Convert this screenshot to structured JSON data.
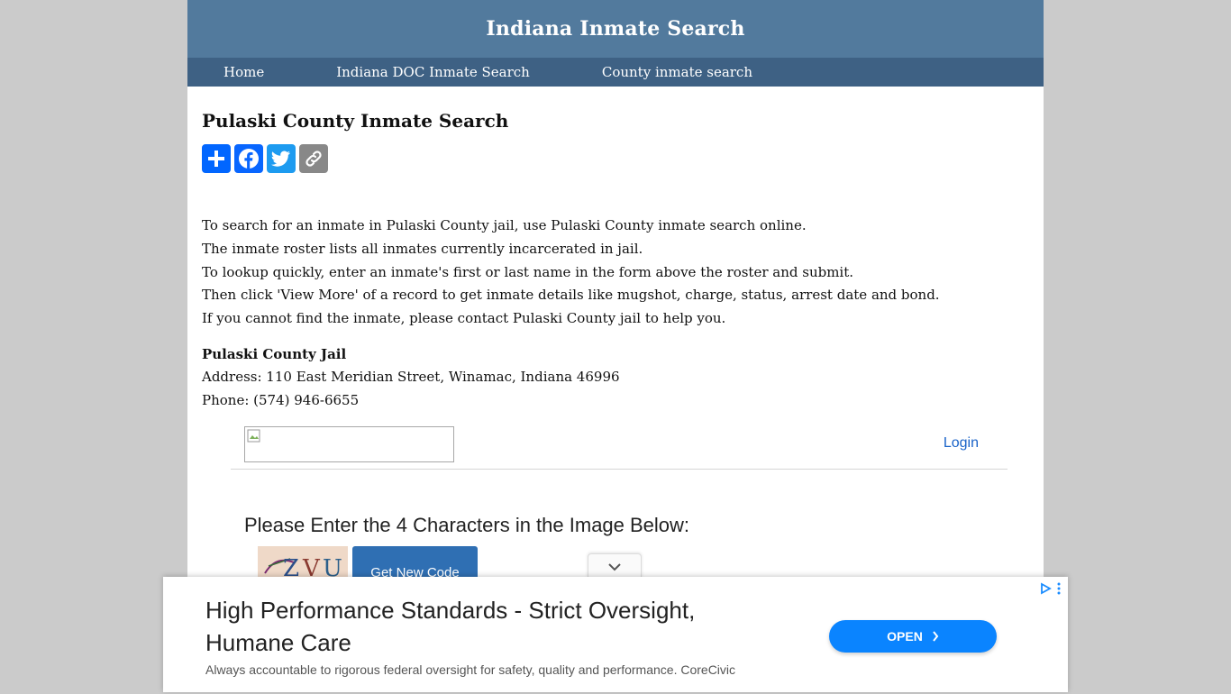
{
  "header": {
    "site_title": "Indiana Inmate Search"
  },
  "nav": [
    {
      "label": "Home"
    },
    {
      "label": "Indiana DOC Inmate Search"
    },
    {
      "label": "County inmate search"
    }
  ],
  "main": {
    "title": "Pulaski County Inmate Search",
    "share_icons": [
      "share-plus-icon",
      "facebook-icon",
      "twitter-icon",
      "copy-link-icon"
    ],
    "intro": [
      "To search for an inmate in Pulaski County jail, use Pulaski County inmate search online.",
      "The inmate roster lists all inmates currently incarcerated in jail.",
      "To lookup quickly, enter an inmate's first or last name in the form above the roster and submit.",
      "Then click 'View More' of a record to get inmate details like mugshot, charge, status, arrest date and bond.",
      "If you cannot find the inmate, please contact Pulaski County jail to help you."
    ],
    "jail": {
      "name": "Pulaski County Jail",
      "address": "Address: 110 East Meridian Street, Winamac, Indiana 46996",
      "phone": "Phone: (574) 946-6655"
    }
  },
  "widget": {
    "login_label": "Login",
    "captcha_prompt": "Please Enter the 4 Characters in the Image Below:",
    "captcha_chars": [
      "Z",
      "V",
      "U"
    ],
    "new_code_label": "Get New Code"
  },
  "ad": {
    "headline": "High Performance Standards - Strict Oversight, Humane Care",
    "subtext": "Always accountable to rigorous federal oversight for safety, quality and performance. CoreCivic",
    "open_label": "OPEN",
    "button_color": "#0a84ff"
  },
  "colors": {
    "header_bg": "#527a9d",
    "nav_bg": "#3e6184",
    "page_bg": "#cbcbcb",
    "link": "#1a63c8"
  }
}
